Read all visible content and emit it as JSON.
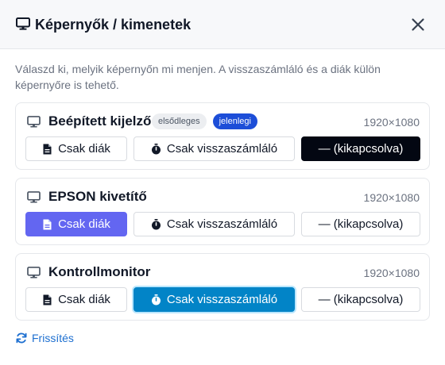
{
  "dialog": {
    "title": "Képernyők / kimenetek",
    "title_icon": "monitor-icon",
    "close_icon": "close-icon",
    "intro": "Válaszd ki, melyik képernyőn mi menjen. A visszaszámláló és a diák külön képernyőre is tehető."
  },
  "options": {
    "slides": "Csak diák",
    "countdown": "Csak visszaszámláló",
    "off": "— (kikapcsolva)"
  },
  "displays": [
    {
      "name": "Beépített kijelző",
      "badge_primary": "elsődleges",
      "badge_current": "jelenlegi",
      "resolution": "1920×1080",
      "selected": "off"
    },
    {
      "name": "EPSON kivetítő",
      "resolution": "1920×1080",
      "selected": "slides"
    },
    {
      "name": "Kontrollmonitor",
      "resolution": "1920×1080",
      "selected": "countdown"
    }
  ],
  "footer": {
    "refresh": "Frissítés",
    "refresh_icon": "refresh-icon"
  },
  "colors": {
    "active_off": "#030712",
    "active_slides": "#6366f1",
    "active_countdown": "#0284c7",
    "badge_current": "#1d4ed8",
    "link": "#1d6fd0"
  }
}
